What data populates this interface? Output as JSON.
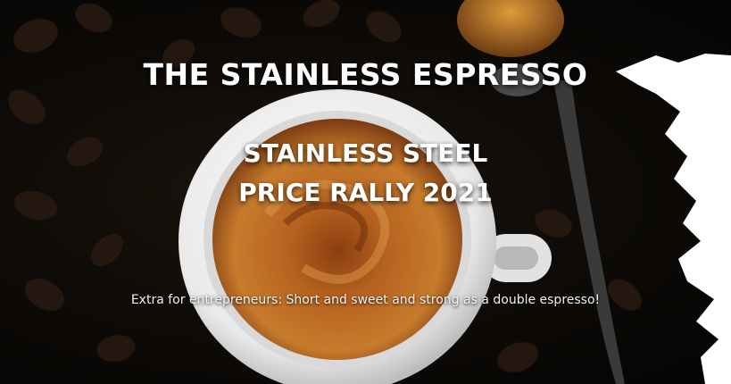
{
  "banner": {
    "brand_title": "THE STAINLESS ESPRESSO",
    "headline_line1": "STAINLESS STEEL",
    "headline_line2": "PRICE RALLY 2021",
    "tagline": "Extra for entrepreneurs: Short and sweet and strong as a double espresso!"
  },
  "colors": {
    "text": "#ffffff",
    "background": "#0b0907",
    "crema": "#b8641c",
    "cup": "#f4f4f4"
  },
  "icons": {
    "cup": "espresso-cup-image",
    "spoon": "spoon-image",
    "beans": "coffee-beans-image"
  }
}
